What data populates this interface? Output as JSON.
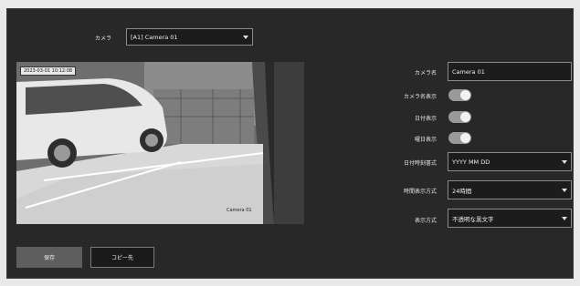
{
  "camera_select": {
    "label": "カメラ",
    "value": "[A1] Camera 01"
  },
  "preview": {
    "timestamp": "2023-03-01 10:12:08",
    "caption": "Camera 01"
  },
  "settings": {
    "camera_name": {
      "label": "カメラ名",
      "value": "Camera 01"
    },
    "show_camera_name": {
      "label": "カメラ名表示",
      "on": true
    },
    "show_date": {
      "label": "日付表示",
      "on": true
    },
    "show_weekday": {
      "label": "曜日表示",
      "on": true
    },
    "date_format": {
      "label": "日付時刻書式",
      "value": "YYYY MM DD"
    },
    "time_format": {
      "label": "時間表示方式",
      "value": "24時間"
    },
    "display_mode": {
      "label": "表示方式",
      "value": "不透明な黒文字"
    }
  },
  "buttons": {
    "save": "保存",
    "copy": "コピー先"
  },
  "colors": {
    "panel": "#282828",
    "field": "#1c1c1c",
    "border": "#8a8a8a",
    "toggle": "#9a9a9a"
  }
}
